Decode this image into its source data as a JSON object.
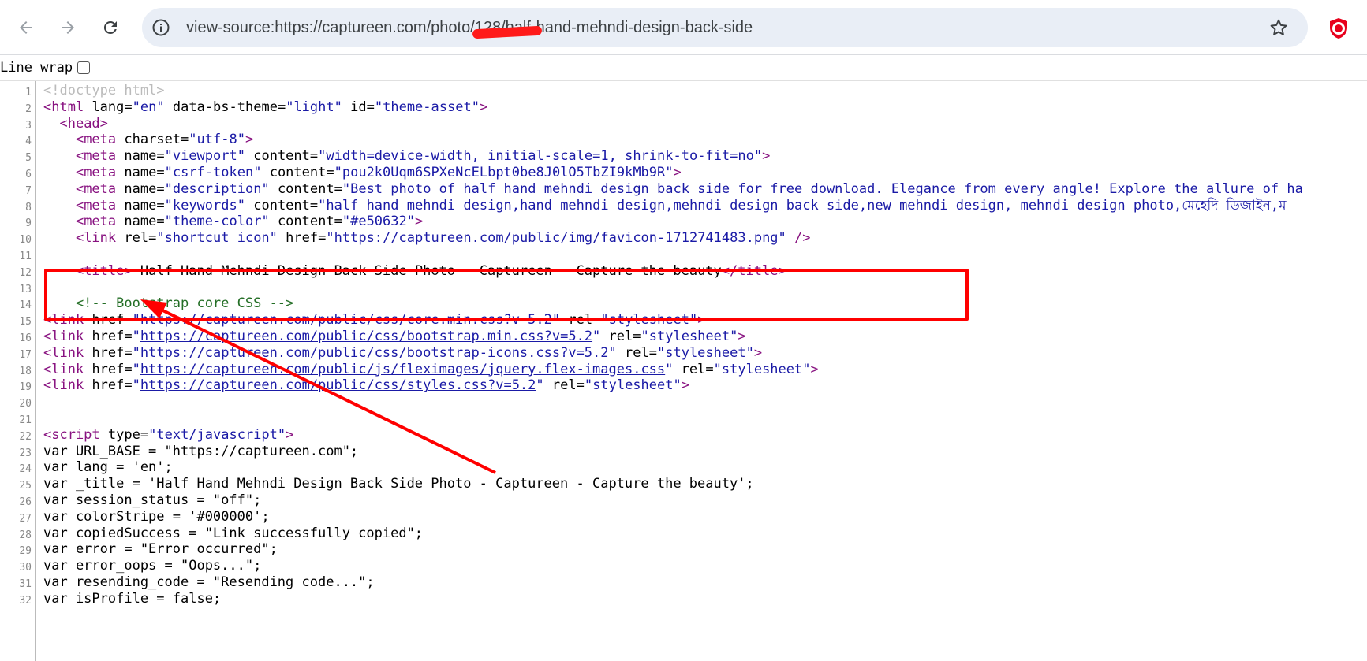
{
  "browser": {
    "url": "view-source:https://captureen.com/photo/128/half-hand-mehndi-design-back-side",
    "icons": {
      "back": "back-arrow-icon",
      "forward": "forward-arrow-icon",
      "reload": "reload-icon",
      "site_info": "info-icon",
      "bookmark": "star-icon",
      "extension": "shield-extension-icon"
    }
  },
  "viewer": {
    "line_wrap_label": "Line wrap",
    "line_wrap_checked": false
  },
  "source_lines": [
    {
      "n": "1",
      "t": "<!doctype html>"
    },
    {
      "n": "2",
      "t": "<html lang=\"en\" data-bs-theme=\"light\" id=\"theme-asset\">"
    },
    {
      "n": "3",
      "t": "  <head>"
    },
    {
      "n": "4",
      "t": "    <meta charset=\"utf-8\">"
    },
    {
      "n": "5",
      "t": "    <meta name=\"viewport\" content=\"width=device-width, initial-scale=1, shrink-to-fit=no\">"
    },
    {
      "n": "6",
      "t": "    <meta name=\"csrf-token\" content=\"pou2k0Uqm6SPXeNcELbpt0be8J0lO5TbZI9kMb9R\">"
    },
    {
      "n": "7",
      "t": "    <meta name=\"description\" content=\"Best photo of half hand mehndi design back side for free download. Elegance from every angle! Explore the allure of hal"
    },
    {
      "n": "8",
      "t": "    <meta name=\"keywords\" content=\"half hand mehndi design,hand mehndi design,mehndi design back side,new mehndi design, mehndi design photo,মেহেদি ডিজাইন,মি"
    },
    {
      "n": "9",
      "t": "    <meta name=\"theme-color\" content=\"#e50632\">"
    },
    {
      "n": "10",
      "t": "    <link rel=\"shortcut icon\" href=\"https://captureen.com/public/img/favicon-1712741483.png\" />"
    },
    {
      "n": "11",
      "t": ""
    },
    {
      "n": "12",
      "t": "    <title> Half Hand Mehndi Design Back Side Photo - Captureen - Capture the beauty</title>"
    },
    {
      "n": "13",
      "t": ""
    },
    {
      "n": "14",
      "t": "    <!-- Bootstrap core CSS -->"
    },
    {
      "n": "15",
      "t": "<link href=\"https://captureen.com/public/css/core.min.css?v=5.2\" rel=\"stylesheet\">"
    },
    {
      "n": "16",
      "t": "<link href=\"https://captureen.com/public/css/bootstrap.min.css?v=5.2\" rel=\"stylesheet\">"
    },
    {
      "n": "17",
      "t": "<link href=\"https://captureen.com/public/css/bootstrap-icons.css?v=5.2\" rel=\"stylesheet\">"
    },
    {
      "n": "18",
      "t": "<link href=\"https://captureen.com/public/js/fleximages/jquery.flex-images.css\" rel=\"stylesheet\">"
    },
    {
      "n": "19",
      "t": "<link href=\"https://captureen.com/public/css/styles.css?v=5.2\" rel=\"stylesheet\">"
    },
    {
      "n": "20",
      "t": ""
    },
    {
      "n": "21",
      "t": ""
    },
    {
      "n": "22",
      "t": "<script type=\"text/javascript\">"
    },
    {
      "n": "23",
      "t": "var URL_BASE = \"https://captureen.com\";"
    },
    {
      "n": "24",
      "t": "var lang = 'en';"
    },
    {
      "n": "25",
      "t": "var _title = 'Half Hand Mehndi Design Back Side Photo - Captureen - Capture the beauty';"
    },
    {
      "n": "26",
      "t": "var session_status = \"off\";"
    },
    {
      "n": "27",
      "t": "var colorStripe = '#000000';"
    },
    {
      "n": "28",
      "t": "var copiedSuccess = \"Link successfully copied\";"
    },
    {
      "n": "29",
      "t": "var error = \"Error occurred\";"
    },
    {
      "n": "30",
      "t": "var error_oops = \"Oops...\";"
    },
    {
      "n": "31",
      "t": "var resending_code = \"Resending code...\";"
    },
    {
      "n": "32",
      "t": "var isProfile = false;"
    }
  ],
  "annotation": {
    "box_color": "#ff0000",
    "arrow_color": "#ff0000"
  },
  "colors": {
    "tag": "#881280",
    "attribute": "#994500",
    "value": "#1a1aa6",
    "comment": "#236e25",
    "doctype": "#bbbbbb"
  }
}
